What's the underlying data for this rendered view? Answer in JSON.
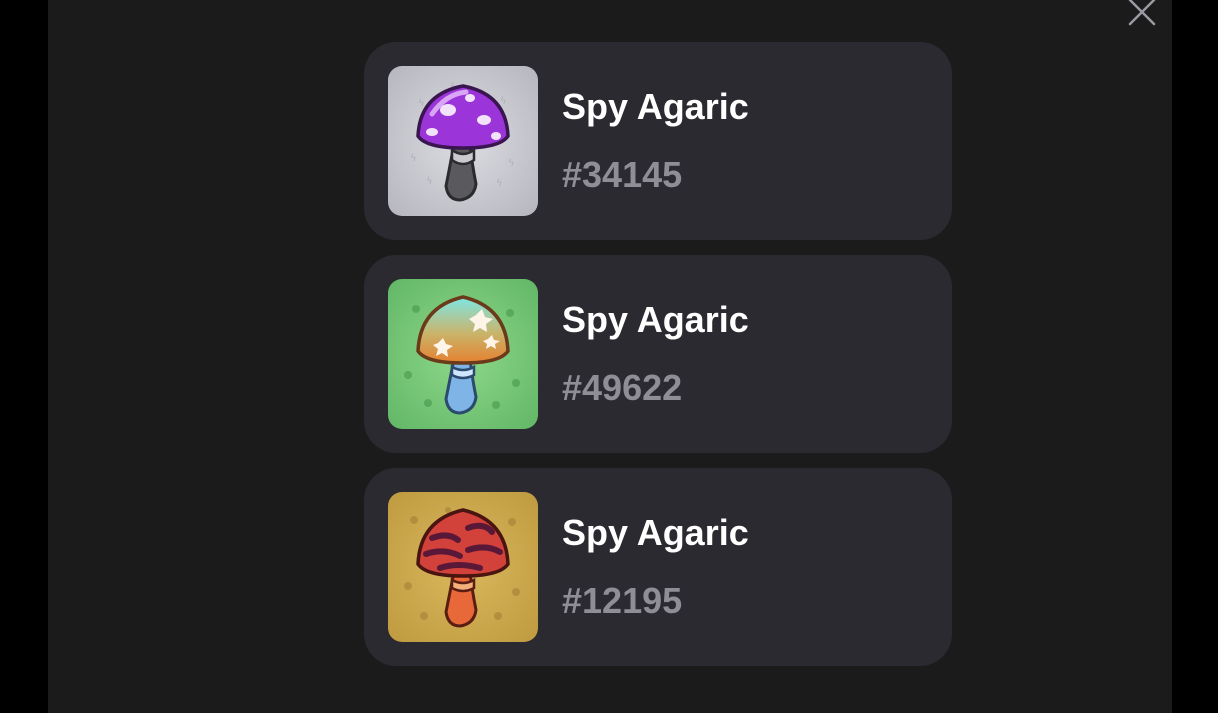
{
  "close_icon": "close-icon",
  "items": [
    {
      "name": "Spy Agaric",
      "number": "#34145",
      "image": "purple-mushroom-image",
      "bg": "#c4c4cb",
      "cap": "#9b34d9",
      "stem": "#5a5a5a"
    },
    {
      "name": "Spy Agaric",
      "number": "#49622",
      "image": "teal-orange-mushroom-image",
      "bg": "#6fbf6f",
      "cap": "#e0893a",
      "stem": "#7fb5e6"
    },
    {
      "name": "Spy Agaric",
      "number": "#12195",
      "image": "red-striped-mushroom-image",
      "bg": "#c9a548",
      "cap": "#d2413a",
      "stem": "#e8683a"
    }
  ]
}
